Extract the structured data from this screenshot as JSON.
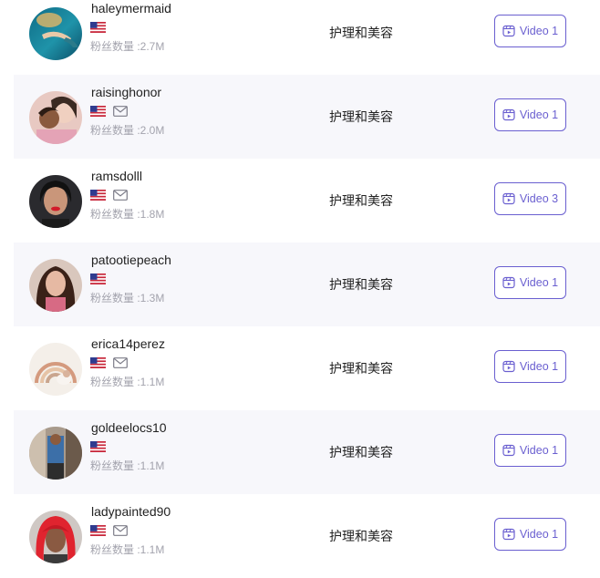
{
  "rows": [
    {
      "username": "haleymermaid",
      "fans_label": "粉丝数量 :2.7M",
      "category": "护理和美容",
      "video_label": "Video 1",
      "has_email": false,
      "avatar": "underwater-swimmer"
    },
    {
      "username": "raisinghonor",
      "fans_label": "粉丝数量 :2.0M",
      "category": "护理和美容",
      "video_label": "Video 1",
      "has_email": true,
      "avatar": "mother-and-child"
    },
    {
      "username": "ramsdolll",
      "fans_label": "粉丝数量 :1.8M",
      "category": "护理和美容",
      "video_label": "Video 3",
      "has_email": true,
      "avatar": "woman-red-lips"
    },
    {
      "username": "patootiepeach",
      "fans_label": "粉丝数量 :1.3M",
      "category": "护理和美容",
      "video_label": "Video 1",
      "has_email": false,
      "avatar": "woman-dark-hair"
    },
    {
      "username": "erica14perez",
      "fans_label": "粉丝数量 :1.1M",
      "category": "护理和美容",
      "video_label": "Video 1",
      "has_email": true,
      "avatar": "rainbow-nursery"
    },
    {
      "username": "goldeelocs10",
      "fans_label": "粉丝数量 :1.1M",
      "category": "护理和美容",
      "video_label": "Video 1",
      "has_email": false,
      "avatar": "room-scene"
    },
    {
      "username": "ladypainted90",
      "fans_label": "粉丝数量 :1.1M",
      "category": "护理和美容",
      "video_label": "Video 1",
      "has_email": true,
      "avatar": "woman-red-hair"
    }
  ],
  "colors": {
    "accent": "#6a5fd0",
    "muted_text": "#a3a3ad",
    "alt_row": "#f7f7fb"
  },
  "icons": {
    "flag": "us-flag-icon",
    "email": "mail-icon",
    "video": "video-icon"
  }
}
